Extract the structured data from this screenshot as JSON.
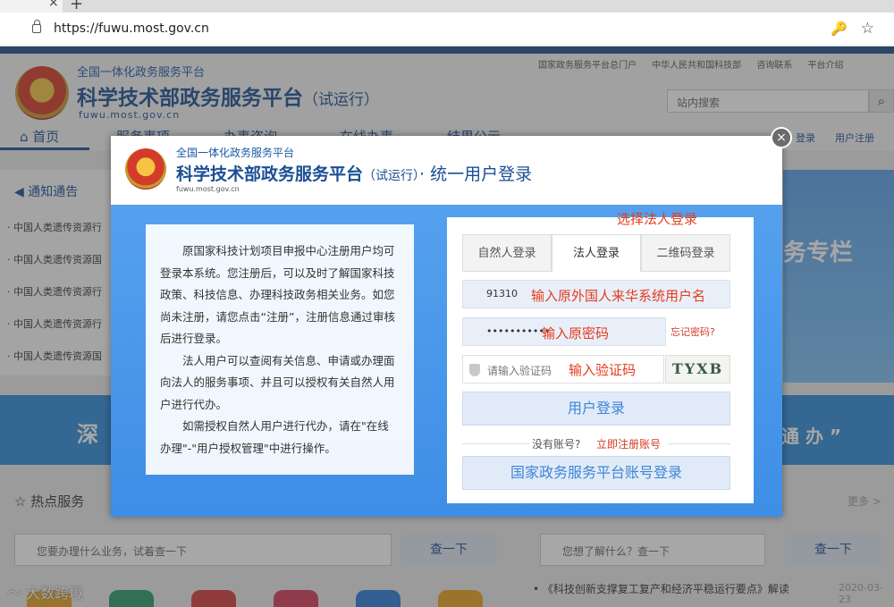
{
  "browser": {
    "url": "https://fuwu.most.gov.cn",
    "tab_close": "×",
    "tab_new": "+"
  },
  "site": {
    "subtitle": "全国一体化政务服务平台",
    "title": "科学技术部政务服务平台",
    "trial": "（试运行）",
    "domain": "fuwu.most.gov.cn",
    "top_links": [
      "国家政务服务平台总门户",
      "中华人民共和国科技部",
      "咨询联系",
      "平台介绍"
    ],
    "search_placeholder": "站内搜索",
    "nav": {
      "home": "首页",
      "items": [
        "服务事项",
        "办事咨询",
        "在线办事",
        "结果公示"
      ],
      "login": "登录",
      "register": "用户注册"
    },
    "notice_title": "通知通告",
    "notice_items": [
      "中国人类遗传资源行",
      "中国人类遗传资源国",
      "中国人类遗传资源行",
      "中国人类遗传资源行",
      "中国人类遗传资源国"
    ],
    "banner_right_text": "务专栏",
    "band_left": "深",
    "band_right": "通 办 ”",
    "hot_title": "热点服务",
    "hot_placeholder": "您要办理什么业务，试着查一下",
    "hot_button": "查一下",
    "more": "更多 >",
    "right_placeholder": "您想了解什么？查一下",
    "right_button": "查一下",
    "news": "《科技创新支撑复工复产和经济平稳运行要点》解读",
    "news_date": "2020-03-23",
    "watermark": "大数跨境"
  },
  "modal": {
    "subtitle": "全国一体化政务服务平台",
    "title": "科学技术部政务服务平台",
    "trial": "（试运行）",
    "title_suffix": "· 统一用户登录",
    "domain": "fuwu.most.gov.cn",
    "close": "×",
    "info": [
      "原国家科技计划项目申报中心注册用户均可登录本系统。您注册后，可以及时了解国家科技政策、科技信息、办理科技政务相关业务。如您尚未注册，请您点击“注册”，注册信息通过审核后进行登录。",
      "法人用户可以查阅有关信息、申请或办理面向法人的服务事项、并且可以授权有关自然人用户进行代办。",
      "如需授权自然人用户进行代办，请在\"在线办理\"-\"用户授权管理\"中进行操作。"
    ],
    "tabs": [
      {
        "label": "自然人登录",
        "active": false
      },
      {
        "label": "法人登录",
        "active": true
      },
      {
        "label": "二维码登录",
        "active": false
      }
    ],
    "username_value": "91310",
    "password_value": "•••••••••••",
    "forgot": "忘记密码?",
    "captcha_placeholder": "请输入验证码",
    "captcha_text": "TYXB",
    "login_button": "用户登录",
    "no_account": "没有账号?",
    "register_link": "立即注册账号",
    "national_button": "国家政务服务平台账号登录"
  },
  "annotations": {
    "tab": "选择法人登录",
    "username": "输入原外国人来华系统用户名",
    "password": "输入原密码",
    "captcha": "输入验证码"
  },
  "colors": {
    "brand_blue": "#1b4f94",
    "annotation_red": "#e53b1c",
    "modal_blue": "#3e8ee6"
  }
}
